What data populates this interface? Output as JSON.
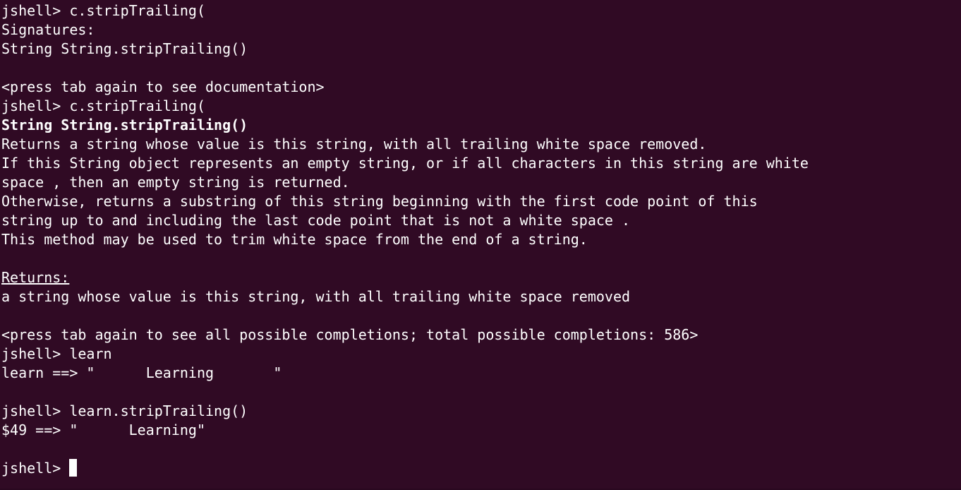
{
  "terminal": {
    "background_color": "#300a24",
    "foreground_color": "#ffffff",
    "lines": [
      {
        "text": "jshell> c.stripTrailing(",
        "style": "normal"
      },
      {
        "text": "Signatures:",
        "style": "normal"
      },
      {
        "text": "String String.stripTrailing()",
        "style": "normal"
      },
      {
        "text": "",
        "style": "normal"
      },
      {
        "text": "<press tab again to see documentation>",
        "style": "normal"
      },
      {
        "text": "jshell> c.stripTrailing(",
        "style": "normal"
      },
      {
        "text": "String String.stripTrailing()",
        "style": "bold"
      },
      {
        "text": "Returns a string whose value is this string, with all trailing white space removed.",
        "style": "normal"
      },
      {
        "text": "If this String object represents an empty string, or if all characters in this string are white",
        "style": "normal"
      },
      {
        "text": "space , then an empty string is returned.",
        "style": "normal"
      },
      {
        "text": "Otherwise, returns a substring of this string beginning with the first code point of this",
        "style": "normal"
      },
      {
        "text": "string up to and including the last code point that is not a white space .",
        "style": "normal"
      },
      {
        "text": "This method may be used to trim white space from the end of a string.",
        "style": "normal"
      },
      {
        "text": "",
        "style": "normal"
      },
      {
        "text": "Returns:",
        "style": "underline"
      },
      {
        "text": "a string whose value is this string, with all trailing white space removed",
        "style": "normal"
      },
      {
        "text": "",
        "style": "normal"
      },
      {
        "text": "<press tab again to see all possible completions; total possible completions: 586>",
        "style": "normal"
      },
      {
        "text": "jshell> learn",
        "style": "normal"
      },
      {
        "text": "learn ==> \"      Learning       \"",
        "style": "normal"
      },
      {
        "text": "",
        "style": "normal"
      },
      {
        "text": "jshell> learn.stripTrailing()",
        "style": "normal"
      },
      {
        "text": "$49 ==> \"      Learning\"",
        "style": "normal"
      },
      {
        "text": "",
        "style": "normal"
      }
    ],
    "prompt": "jshell> "
  }
}
